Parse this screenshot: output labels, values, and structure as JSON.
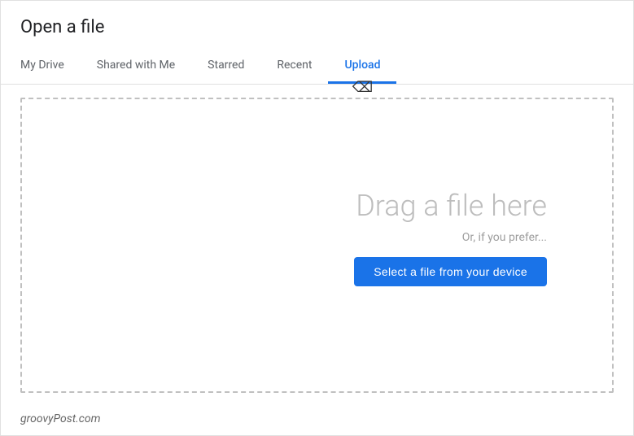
{
  "dialog": {
    "title": "Open a file"
  },
  "tabs": [
    {
      "id": "my-drive",
      "label": "My Drive",
      "active": false
    },
    {
      "id": "shared-with-me",
      "label": "Shared with Me",
      "active": false
    },
    {
      "id": "starred",
      "label": "Starred",
      "active": false
    },
    {
      "id": "recent",
      "label": "Recent",
      "active": false
    },
    {
      "id": "upload",
      "label": "Upload",
      "active": true
    }
  ],
  "upload": {
    "drag_text": "Drag a file here",
    "or_text": "Or, if you prefer...",
    "select_button": "Select a file from your device"
  },
  "footer": {
    "branding": "groovyPost.com"
  }
}
